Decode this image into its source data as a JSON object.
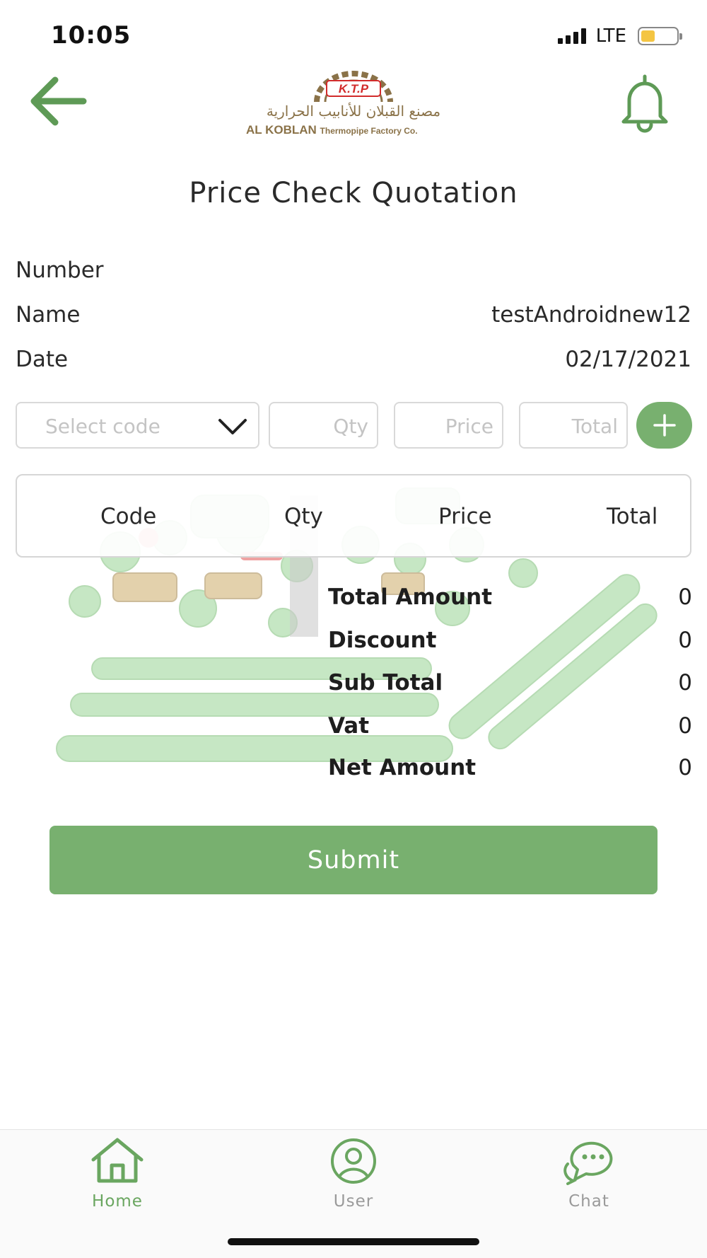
{
  "status_bar": {
    "time": "10:05",
    "network": "LTE"
  },
  "header": {
    "logo_badge": "K.T.P",
    "logo_arabic": "مصنع القبلان للأنابيب الحرارية",
    "logo_company_bold": "AL KOBLAN",
    "logo_company_rest": "Thermopipe Factory Co.",
    "back_icon": "arrow-left-icon",
    "notification_icon": "bell-icon"
  },
  "page": {
    "title": "Price Check Quotation"
  },
  "info": {
    "number_label": "Number",
    "number_value": "",
    "name_label": "Name",
    "name_value": "testAndroidnew12",
    "date_label": "Date",
    "date_value": "02/17/2021"
  },
  "inputs": {
    "code_placeholder": "Select code",
    "qty_placeholder": "Qty",
    "price_placeholder": "Price",
    "total_placeholder": "Total",
    "add_icon": "plus-icon"
  },
  "table": {
    "headers": [
      "Code",
      "Qty",
      "Price",
      "Total"
    ],
    "rows": []
  },
  "summary": {
    "total_amount_label": "Total Amount",
    "total_amount_value": "0",
    "discount_label": "Discount",
    "discount_value": "0",
    "sub_total_label": "Sub Total",
    "sub_total_value": "0",
    "vat_label": "Vat",
    "vat_value": "0",
    "net_amount_label": "Net Amount",
    "net_amount_value": "0"
  },
  "actions": {
    "submit_label": "Submit"
  },
  "bottom_nav": {
    "items": [
      {
        "label": "Home",
        "icon": "home-icon",
        "active": true
      },
      {
        "label": "User",
        "icon": "user-icon",
        "active": false
      },
      {
        "label": "Chat",
        "icon": "chat-icon",
        "active": false
      }
    ]
  },
  "colors": {
    "accent": "#78b06f",
    "accent_dark": "#5e9a56",
    "logo_gold": "#8a7248",
    "logo_red": "#d22b2b"
  }
}
